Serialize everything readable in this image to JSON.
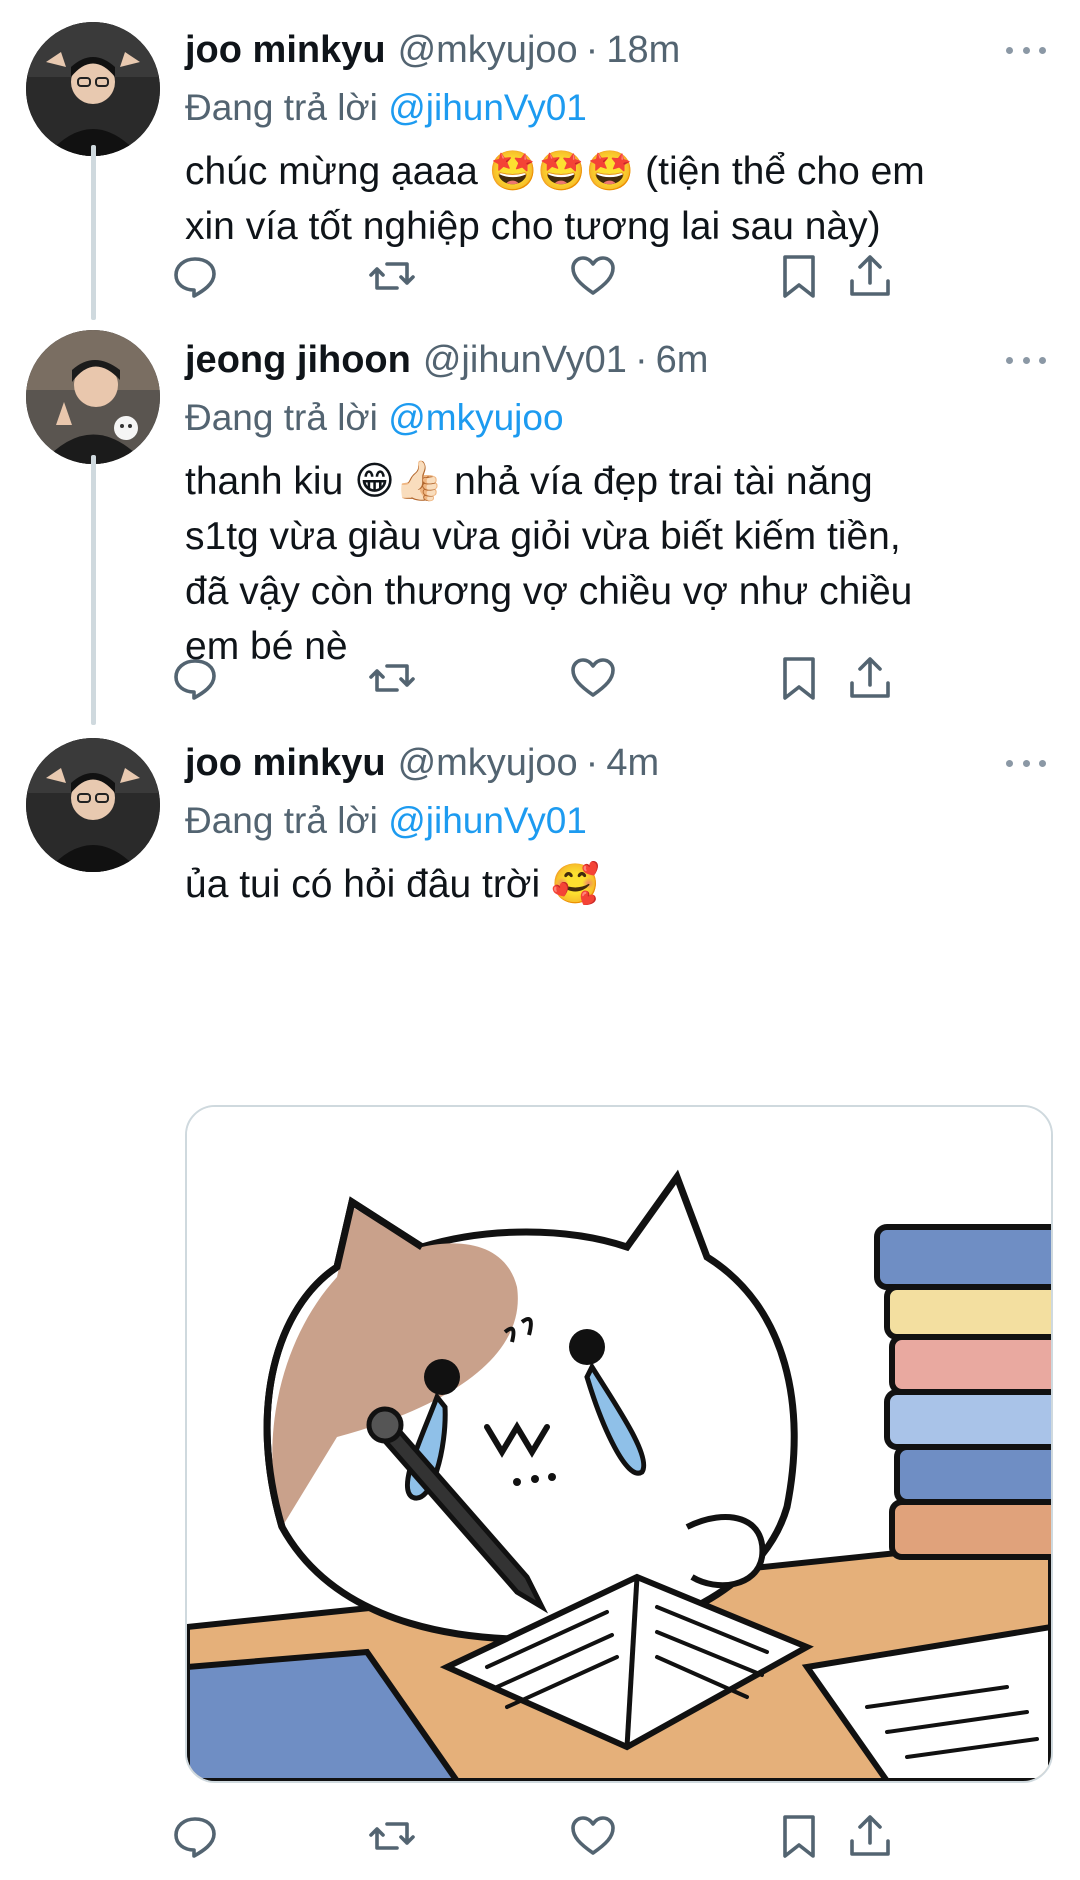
{
  "tweets": [
    {
      "name": "joo minkyu",
      "handle": "@mkyujoo",
      "separator": "·",
      "time": "18m",
      "reply_prefix": "Đang trả lời",
      "reply_to": "@jihunVy01",
      "text": "chúc mừng ạaaa 🤩🤩🤩 (tiện thể cho em\nxin vía tốt nghiệp cho tương lai sau này)"
    },
    {
      "name": "jeong jihoon",
      "handle": "@jihunVy01",
      "separator": "·",
      "time": "6m",
      "reply_prefix": "Đang trả lời",
      "reply_to": "@mkyujoo",
      "text": "thanh kiu 😁👍🏻 nhả vía đẹp trai tài năng\ns1tg vừa giàu vừa giỏi vừa biết kiếm tiền,\nđã vậy còn thương vợ chiều vợ như chiều\nem bé nè"
    },
    {
      "name": "joo minkyu",
      "handle": "@mkyujoo",
      "separator": "·",
      "time": "4m",
      "reply_prefix": "Đang trả lời",
      "reply_to": "@jihunVy01",
      "text": "ủa tui có hỏi đâu trời 🥰"
    }
  ],
  "icons": {
    "more": "more-horizontal-icon",
    "reply": "reply-bubble-icon",
    "retweet": "retweet-icon",
    "like": "heart-icon",
    "bookmark": "bookmark-icon",
    "share": "share-upload-icon"
  },
  "colors": {
    "mention": "#1d9bf0",
    "secondary_text": "#536471",
    "thread_line": "#cfd9de"
  }
}
